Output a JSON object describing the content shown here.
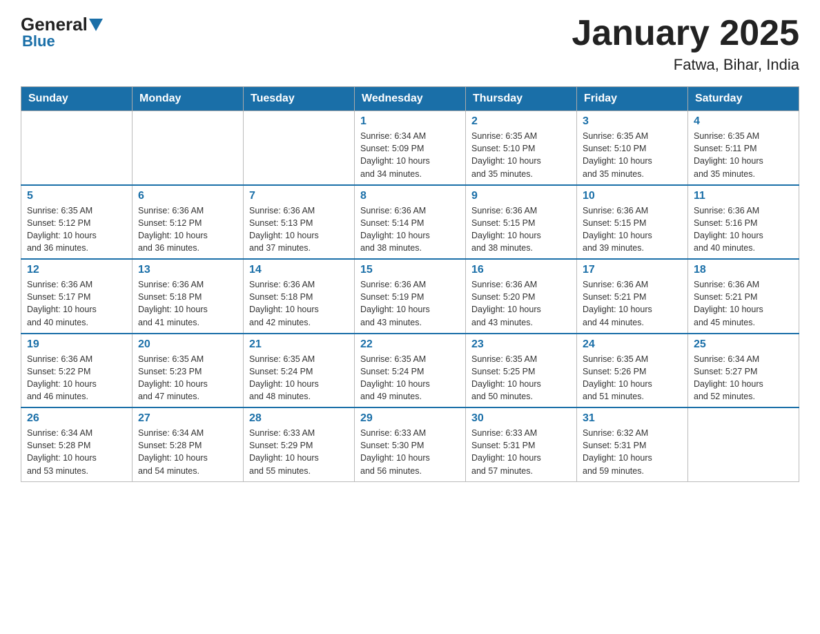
{
  "logo": {
    "general": "General",
    "blue": "Blue"
  },
  "title": "January 2025",
  "subtitle": "Fatwa, Bihar, India",
  "days_of_week": [
    "Sunday",
    "Monday",
    "Tuesday",
    "Wednesday",
    "Thursday",
    "Friday",
    "Saturday"
  ],
  "weeks": [
    [
      {
        "num": "",
        "info": ""
      },
      {
        "num": "",
        "info": ""
      },
      {
        "num": "",
        "info": ""
      },
      {
        "num": "1",
        "info": "Sunrise: 6:34 AM\nSunset: 5:09 PM\nDaylight: 10 hours\nand 34 minutes."
      },
      {
        "num": "2",
        "info": "Sunrise: 6:35 AM\nSunset: 5:10 PM\nDaylight: 10 hours\nand 35 minutes."
      },
      {
        "num": "3",
        "info": "Sunrise: 6:35 AM\nSunset: 5:10 PM\nDaylight: 10 hours\nand 35 minutes."
      },
      {
        "num": "4",
        "info": "Sunrise: 6:35 AM\nSunset: 5:11 PM\nDaylight: 10 hours\nand 35 minutes."
      }
    ],
    [
      {
        "num": "5",
        "info": "Sunrise: 6:35 AM\nSunset: 5:12 PM\nDaylight: 10 hours\nand 36 minutes."
      },
      {
        "num": "6",
        "info": "Sunrise: 6:36 AM\nSunset: 5:12 PM\nDaylight: 10 hours\nand 36 minutes."
      },
      {
        "num": "7",
        "info": "Sunrise: 6:36 AM\nSunset: 5:13 PM\nDaylight: 10 hours\nand 37 minutes."
      },
      {
        "num": "8",
        "info": "Sunrise: 6:36 AM\nSunset: 5:14 PM\nDaylight: 10 hours\nand 38 minutes."
      },
      {
        "num": "9",
        "info": "Sunrise: 6:36 AM\nSunset: 5:15 PM\nDaylight: 10 hours\nand 38 minutes."
      },
      {
        "num": "10",
        "info": "Sunrise: 6:36 AM\nSunset: 5:15 PM\nDaylight: 10 hours\nand 39 minutes."
      },
      {
        "num": "11",
        "info": "Sunrise: 6:36 AM\nSunset: 5:16 PM\nDaylight: 10 hours\nand 40 minutes."
      }
    ],
    [
      {
        "num": "12",
        "info": "Sunrise: 6:36 AM\nSunset: 5:17 PM\nDaylight: 10 hours\nand 40 minutes."
      },
      {
        "num": "13",
        "info": "Sunrise: 6:36 AM\nSunset: 5:18 PM\nDaylight: 10 hours\nand 41 minutes."
      },
      {
        "num": "14",
        "info": "Sunrise: 6:36 AM\nSunset: 5:18 PM\nDaylight: 10 hours\nand 42 minutes."
      },
      {
        "num": "15",
        "info": "Sunrise: 6:36 AM\nSunset: 5:19 PM\nDaylight: 10 hours\nand 43 minutes."
      },
      {
        "num": "16",
        "info": "Sunrise: 6:36 AM\nSunset: 5:20 PM\nDaylight: 10 hours\nand 43 minutes."
      },
      {
        "num": "17",
        "info": "Sunrise: 6:36 AM\nSunset: 5:21 PM\nDaylight: 10 hours\nand 44 minutes."
      },
      {
        "num": "18",
        "info": "Sunrise: 6:36 AM\nSunset: 5:21 PM\nDaylight: 10 hours\nand 45 minutes."
      }
    ],
    [
      {
        "num": "19",
        "info": "Sunrise: 6:36 AM\nSunset: 5:22 PM\nDaylight: 10 hours\nand 46 minutes."
      },
      {
        "num": "20",
        "info": "Sunrise: 6:35 AM\nSunset: 5:23 PM\nDaylight: 10 hours\nand 47 minutes."
      },
      {
        "num": "21",
        "info": "Sunrise: 6:35 AM\nSunset: 5:24 PM\nDaylight: 10 hours\nand 48 minutes."
      },
      {
        "num": "22",
        "info": "Sunrise: 6:35 AM\nSunset: 5:24 PM\nDaylight: 10 hours\nand 49 minutes."
      },
      {
        "num": "23",
        "info": "Sunrise: 6:35 AM\nSunset: 5:25 PM\nDaylight: 10 hours\nand 50 minutes."
      },
      {
        "num": "24",
        "info": "Sunrise: 6:35 AM\nSunset: 5:26 PM\nDaylight: 10 hours\nand 51 minutes."
      },
      {
        "num": "25",
        "info": "Sunrise: 6:34 AM\nSunset: 5:27 PM\nDaylight: 10 hours\nand 52 minutes."
      }
    ],
    [
      {
        "num": "26",
        "info": "Sunrise: 6:34 AM\nSunset: 5:28 PM\nDaylight: 10 hours\nand 53 minutes."
      },
      {
        "num": "27",
        "info": "Sunrise: 6:34 AM\nSunset: 5:28 PM\nDaylight: 10 hours\nand 54 minutes."
      },
      {
        "num": "28",
        "info": "Sunrise: 6:33 AM\nSunset: 5:29 PM\nDaylight: 10 hours\nand 55 minutes."
      },
      {
        "num": "29",
        "info": "Sunrise: 6:33 AM\nSunset: 5:30 PM\nDaylight: 10 hours\nand 56 minutes."
      },
      {
        "num": "30",
        "info": "Sunrise: 6:33 AM\nSunset: 5:31 PM\nDaylight: 10 hours\nand 57 minutes."
      },
      {
        "num": "31",
        "info": "Sunrise: 6:32 AM\nSunset: 5:31 PM\nDaylight: 10 hours\nand 59 minutes."
      },
      {
        "num": "",
        "info": ""
      }
    ]
  ]
}
